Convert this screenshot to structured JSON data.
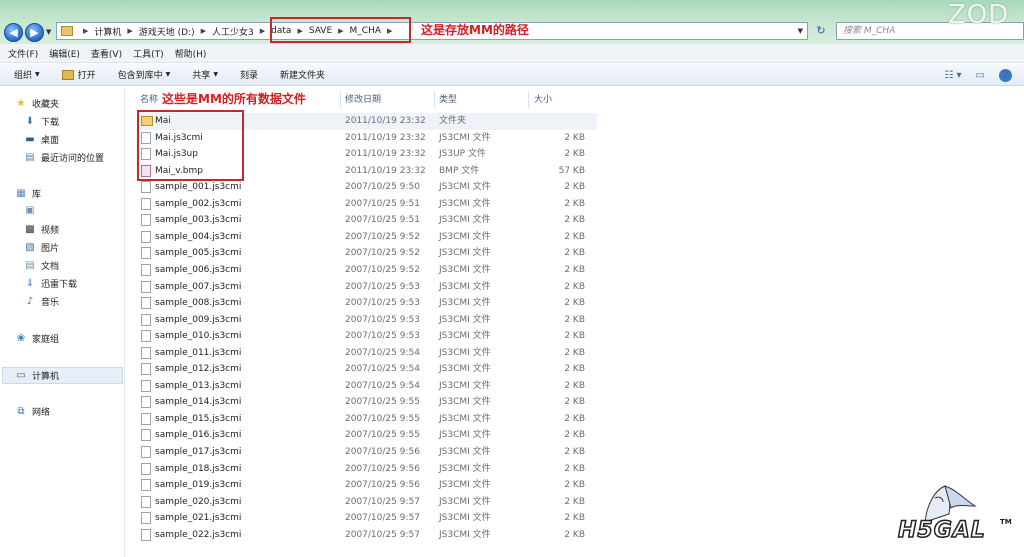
{
  "address": {
    "crumbs": [
      "计算机",
      "游戏天地 (D:)",
      "人工少女3",
      "data",
      "SAVE",
      "M_CHA"
    ],
    "search_placeholder": "搜索 M_CHA",
    "annotation": "这是存放MM的路径"
  },
  "watermark": "ZOD",
  "menu": [
    "文件(F)",
    "编辑(E)",
    "查看(V)",
    "工具(T)",
    "帮助(H)"
  ],
  "commands": [
    "组织",
    "打开",
    "包含到库中",
    "共享",
    "刻录",
    "新建文件夹"
  ],
  "sidebar": {
    "favorites": "收藏夹",
    "fav_items": [
      "下载",
      "桌面",
      "最近访问的位置"
    ],
    "library": "库",
    "lib_items": [
      "视频",
      "图片",
      "文档",
      "迅雷下载",
      "音乐"
    ],
    "homegroup": "家庭组",
    "computer": "计算机",
    "network": "网络"
  },
  "columns": {
    "name": "名称",
    "date": "修改日期",
    "type": "类型",
    "size": "大小"
  },
  "files_annotation": "这些是MM的所有数据文件",
  "files": [
    {
      "name": "Mai",
      "date": "2011/10/19 23:32",
      "type": "文件夹",
      "size": "",
      "kind": "folder"
    },
    {
      "name": "Mai.js3cmi",
      "date": "2011/10/19 23:32",
      "type": "JS3CMI 文件",
      "size": "2 KB",
      "kind": "file"
    },
    {
      "name": "Mai.js3up",
      "date": "2011/10/19 23:32",
      "type": "JS3UP 文件",
      "size": "2 KB",
      "kind": "file"
    },
    {
      "name": "Mai_v.bmp",
      "date": "2011/10/19 23:32",
      "type": "BMP 文件",
      "size": "57 KB",
      "kind": "bmp"
    },
    {
      "name": "sample_001.js3cmi",
      "date": "2007/10/25 9:50",
      "type": "JS3CMI 文件",
      "size": "2 KB",
      "kind": "file"
    },
    {
      "name": "sample_002.js3cmi",
      "date": "2007/10/25 9:51",
      "type": "JS3CMI 文件",
      "size": "2 KB",
      "kind": "file"
    },
    {
      "name": "sample_003.js3cmi",
      "date": "2007/10/25 9:51",
      "type": "JS3CMI 文件",
      "size": "2 KB",
      "kind": "file"
    },
    {
      "name": "sample_004.js3cmi",
      "date": "2007/10/25 9:52",
      "type": "JS3CMI 文件",
      "size": "2 KB",
      "kind": "file"
    },
    {
      "name": "sample_005.js3cmi",
      "date": "2007/10/25 9:52",
      "type": "JS3CMI 文件",
      "size": "2 KB",
      "kind": "file"
    },
    {
      "name": "sample_006.js3cmi",
      "date": "2007/10/25 9:52",
      "type": "JS3CMI 文件",
      "size": "2 KB",
      "kind": "file"
    },
    {
      "name": "sample_007.js3cmi",
      "date": "2007/10/25 9:53",
      "type": "JS3CMI 文件",
      "size": "2 KB",
      "kind": "file"
    },
    {
      "name": "sample_008.js3cmi",
      "date": "2007/10/25 9:53",
      "type": "JS3CMI 文件",
      "size": "2 KB",
      "kind": "file"
    },
    {
      "name": "sample_009.js3cmi",
      "date": "2007/10/25 9:53",
      "type": "JS3CMI 文件",
      "size": "2 KB",
      "kind": "file"
    },
    {
      "name": "sample_010.js3cmi",
      "date": "2007/10/25 9:53",
      "type": "JS3CMI 文件",
      "size": "2 KB",
      "kind": "file"
    },
    {
      "name": "sample_011.js3cmi",
      "date": "2007/10/25 9:54",
      "type": "JS3CMI 文件",
      "size": "2 KB",
      "kind": "file"
    },
    {
      "name": "sample_012.js3cmi",
      "date": "2007/10/25 9:54",
      "type": "JS3CMI 文件",
      "size": "2 KB",
      "kind": "file"
    },
    {
      "name": "sample_013.js3cmi",
      "date": "2007/10/25 9:54",
      "type": "JS3CMI 文件",
      "size": "2 KB",
      "kind": "file"
    },
    {
      "name": "sample_014.js3cmi",
      "date": "2007/10/25 9:55",
      "type": "JS3CMI 文件",
      "size": "2 KB",
      "kind": "file"
    },
    {
      "name": "sample_015.js3cmi",
      "date": "2007/10/25 9:55",
      "type": "JS3CMI 文件",
      "size": "2 KB",
      "kind": "file"
    },
    {
      "name": "sample_016.js3cmi",
      "date": "2007/10/25 9:55",
      "type": "JS3CMI 文件",
      "size": "2 KB",
      "kind": "file"
    },
    {
      "name": "sample_017.js3cmi",
      "date": "2007/10/25 9:56",
      "type": "JS3CMI 文件",
      "size": "2 KB",
      "kind": "file"
    },
    {
      "name": "sample_018.js3cmi",
      "date": "2007/10/25 9:56",
      "type": "JS3CMI 文件",
      "size": "2 KB",
      "kind": "file"
    },
    {
      "name": "sample_019.js3cmi",
      "date": "2007/10/25 9:56",
      "type": "JS3CMI 文件",
      "size": "2 KB",
      "kind": "file"
    },
    {
      "name": "sample_020.js3cmi",
      "date": "2007/10/25 9:57",
      "type": "JS3CMI 文件",
      "size": "2 KB",
      "kind": "file"
    },
    {
      "name": "sample_021.js3cmi",
      "date": "2007/10/25 9:57",
      "type": "JS3CMI 文件",
      "size": "2 KB",
      "kind": "file"
    },
    {
      "name": "sample_022.js3cmi",
      "date": "2007/10/25 9:57",
      "type": "JS3CMI 文件",
      "size": "2 KB",
      "kind": "file"
    }
  ],
  "logo": {
    "text": "H5GAL",
    "tm": "TM"
  },
  "colors": {
    "annotation_red": "#d42020",
    "accent_blue": "#2d76cf",
    "topbar_green": "#a9d8bc"
  }
}
